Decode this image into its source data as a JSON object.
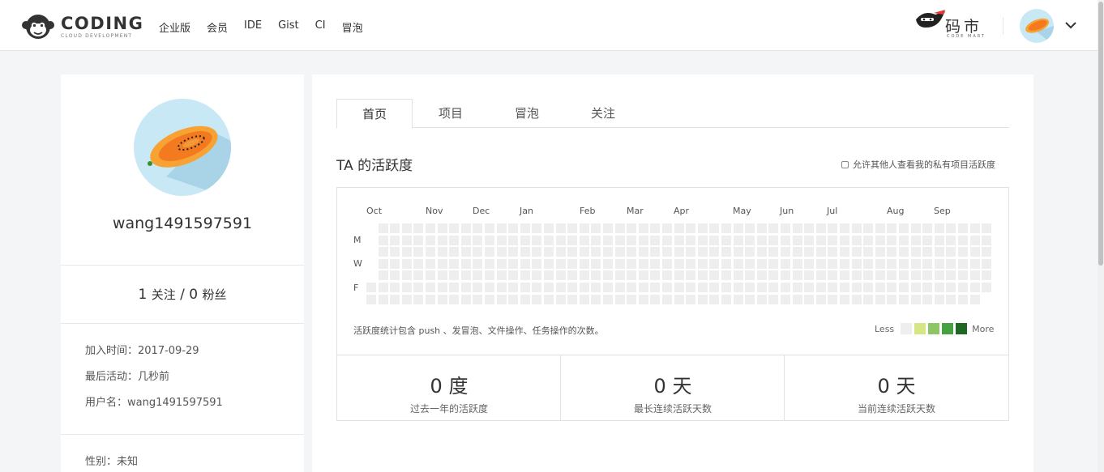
{
  "header": {
    "logo_name": "CODING",
    "logo_sub": "CLOUD DEVELOPMENT",
    "nav": [
      "企业版",
      "会员",
      "IDE",
      "Gist",
      "CI",
      "冒泡"
    ],
    "market_name": "码市",
    "market_sub": "CODE MART"
  },
  "profile": {
    "username": "wang1491597591",
    "following_count": "1",
    "following_label": "关注",
    "separator": "/",
    "followers_count": "0",
    "followers_label": "粉丝",
    "joined": "加入时间：2017-09-29",
    "last_active": "最后活动：几秒前",
    "username_row": "用户名：wang1491597591",
    "gender": "性别：未知"
  },
  "main": {
    "tabs": [
      "首页",
      "项目",
      "冒泡",
      "关注"
    ],
    "active_tab": 0,
    "activity_title": "TA 的活跃度",
    "privacy_label": "允许其他人查看我的私有项目活跃度",
    "months": [
      "Oct",
      "Nov",
      "Dec",
      "Jan",
      "Feb",
      "Mar",
      "Apr",
      "May",
      "Jun",
      "Jul",
      "Aug",
      "Sep"
    ],
    "weekdays": [
      "M",
      "W",
      "F"
    ],
    "note": "活跃度统计包含 push 、发冒泡、文件操作、任务操作的次数。",
    "legend_less": "Less",
    "legend_more": "More",
    "legend_colors": [
      "#eeeeee",
      "#d6e685",
      "#8cc665",
      "#44a340",
      "#1e6823"
    ],
    "stats": [
      {
        "value": "0 度",
        "label": "过去一年的活跃度"
      },
      {
        "value": "0 天",
        "label": "最长连续活跃天数"
      },
      {
        "value": "0 天",
        "label": "当前连续活跃天数"
      }
    ]
  },
  "colors": {
    "calendar_empty": "#eeeeee",
    "avatar_bg": "#c9e8f5",
    "papaya_skin": "#f7a233",
    "papaya_flesh": "#f37a1f"
  }
}
